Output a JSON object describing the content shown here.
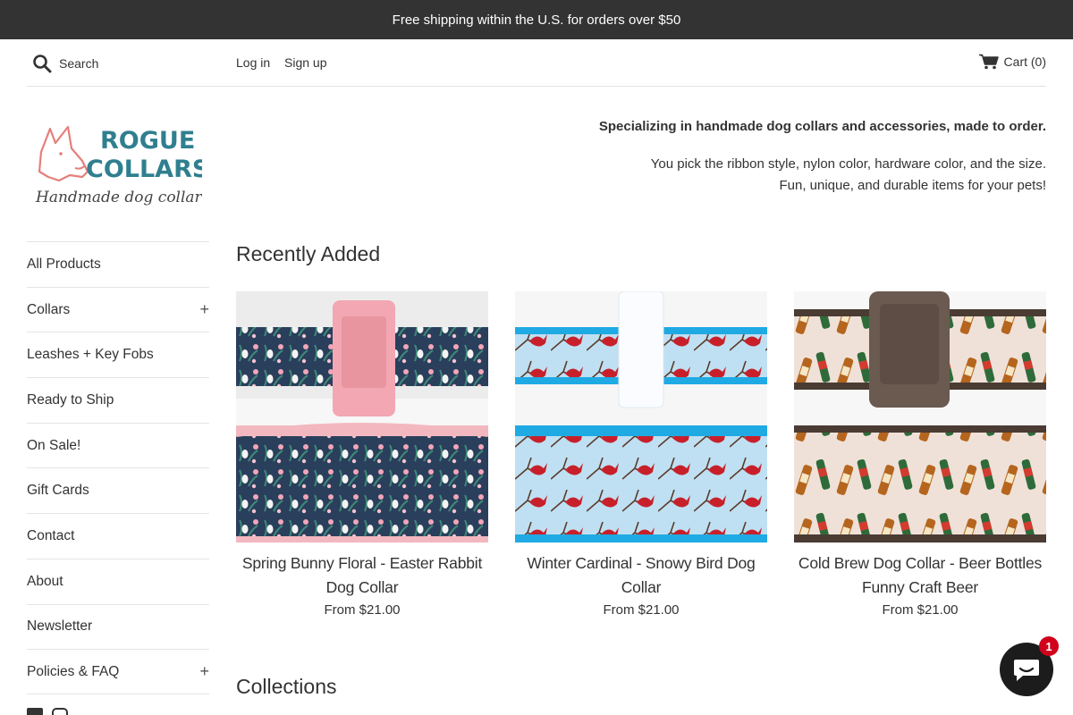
{
  "announcement": {
    "text": "Free shipping within the U.S. for orders over $50"
  },
  "header": {
    "search_placeholder": "Search",
    "login_label": "Log in",
    "signup_label": "Sign up",
    "cart_label": "Cart (0)",
    "icons": {
      "search": "search-icon",
      "cart": "cart-icon"
    }
  },
  "logo": {
    "line1": "ROGUE",
    "line2": "COLLARS",
    "tagline": "Handmade dog collars"
  },
  "intro": {
    "headline": "Specializing in handmade dog collars and accessories, made to order.",
    "line1": "You pick the ribbon style, nylon color, hardware color, and the size.",
    "line2": "Fun, unique, and durable items for your pets!"
  },
  "sidebar": {
    "items": [
      {
        "label": "All Products",
        "expand": ""
      },
      {
        "label": "Collars",
        "expand": "+"
      },
      {
        "label": "Leashes + Key Fobs",
        "expand": ""
      },
      {
        "label": "Ready to Ship",
        "expand": ""
      },
      {
        "label": "On Sale!",
        "expand": ""
      },
      {
        "label": "Gift Cards",
        "expand": ""
      },
      {
        "label": "Contact",
        "expand": ""
      },
      {
        "label": "About",
        "expand": ""
      },
      {
        "label": "Newsletter",
        "expand": ""
      },
      {
        "label": "Policies & FAQ",
        "expand": "+"
      }
    ],
    "social_icons": [
      "facebook-icon",
      "instagram-icon"
    ]
  },
  "main": {
    "recent_title": "Recently Added",
    "collections_title": "Collections",
    "products": [
      {
        "name": "Spring Bunny Floral - Easter Rabbit Dog Collar",
        "price": "From $21.00"
      },
      {
        "name": "Winter Cardinal - Snowy Bird Dog Collar",
        "price": "From $21.00"
      },
      {
        "name": "Cold Brew Dog Collar - Beer Bottles Funny Craft Beer",
        "price": "From $21.00"
      }
    ]
  },
  "chat": {
    "badge_count": "1",
    "icon": "chat-icon"
  },
  "colors": {
    "announcement_bg": "#333333",
    "text": "#333333",
    "divider": "#e4e4e4",
    "logo_pink": "#e57f7a",
    "logo_teal": "#2f7f8f",
    "chat_bg": "#1c1c1c",
    "badge_red": "#d0021b"
  }
}
